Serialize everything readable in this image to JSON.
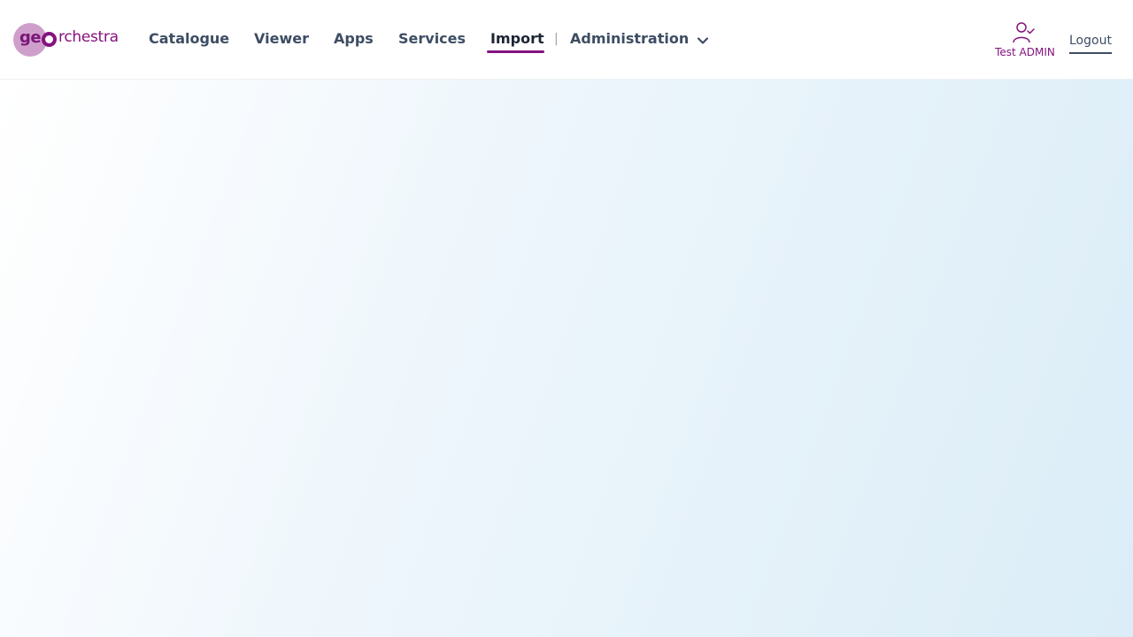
{
  "brand": {
    "logo_prefix": "ge",
    "logo_suffix": "rchestra",
    "primary_color": "#85137f",
    "logo_light_color": "#cf9fcb"
  },
  "nav": {
    "items": [
      {
        "label": "Catalogue"
      },
      {
        "label": "Viewer"
      },
      {
        "label": "Apps"
      },
      {
        "label": "Services"
      },
      {
        "label": "Import",
        "active": true
      },
      {
        "label": "Administration",
        "has_dropdown": true
      }
    ],
    "separator": "|"
  },
  "user": {
    "name": "Test ADMIN",
    "icon": "user-check-icon",
    "logout_label": "Logout"
  },
  "content": {
    "background_colors": [
      "#ffffff",
      "#dbedf7"
    ]
  }
}
